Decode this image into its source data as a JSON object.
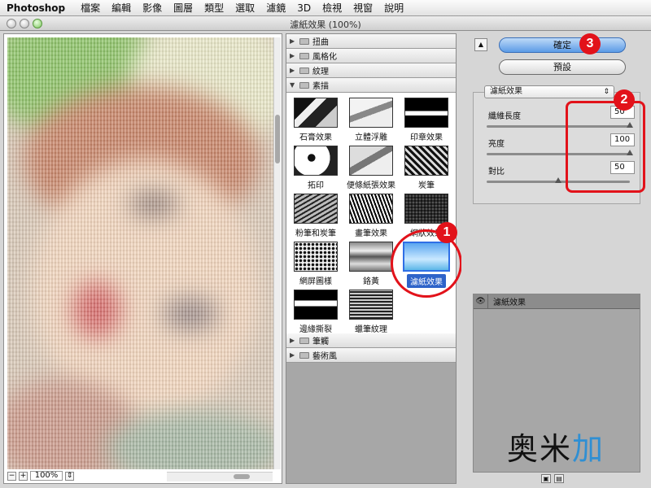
{
  "menubar": {
    "app": "Photoshop",
    "items": [
      "檔案",
      "編輯",
      "影像",
      "圖層",
      "類型",
      "選取",
      "濾鏡",
      "3D",
      "檢視",
      "視窗",
      "說明"
    ]
  },
  "window": {
    "title": "濾紙效果 (100%)"
  },
  "preview": {
    "zoom": "100%",
    "zoom_out": "−",
    "zoom_in": "+",
    "zoom_caret": "⇕"
  },
  "gallery": {
    "categories_top": [
      {
        "name": "扭曲",
        "expanded": false
      },
      {
        "name": "風格化",
        "expanded": false
      },
      {
        "name": "紋理",
        "expanded": false
      },
      {
        "name": "素描",
        "expanded": true
      }
    ],
    "sketch_filters": [
      "石膏效果",
      "立體浮雕",
      "印章效果",
      "拓印",
      "便條紙張效果",
      "炭筆",
      "粉筆和炭筆",
      "畫筆效果",
      "網狀效果",
      "網屏圖樣",
      "鉻黃",
      "濾紙效果",
      "邊緣撕裂",
      "蠟筆紋理"
    ],
    "selected_filter": "濾紙效果",
    "categories_bottom": [
      {
        "name": "筆觸",
        "expanded": false
      },
      {
        "name": "藝術風",
        "expanded": false
      }
    ],
    "callout": "1"
  },
  "settings": {
    "collapse_button": "▲",
    "ok": "確定",
    "default": "預設",
    "filter_select": "濾紙效果",
    "select_caret": "⇕",
    "params": [
      {
        "label": "纖維長度",
        "value": "50",
        "level": 1.0
      },
      {
        "label": "亮度",
        "value": "100",
        "level": 1.0
      },
      {
        "label": "對比",
        "value": "50",
        "level": 0.5
      }
    ],
    "callout_params": "2",
    "callout_ok": "3"
  },
  "layers": {
    "eye": "👁",
    "rows": [
      "濾紙效果"
    ],
    "new_icon": "▣",
    "trash_icon": "▤"
  },
  "watermark": {
    "text1": "奥米",
    "text2": "加"
  },
  "colors": {
    "accent": "#2e63c9",
    "callout_red": "#e2121a",
    "primary_button": "#5b9be6"
  }
}
